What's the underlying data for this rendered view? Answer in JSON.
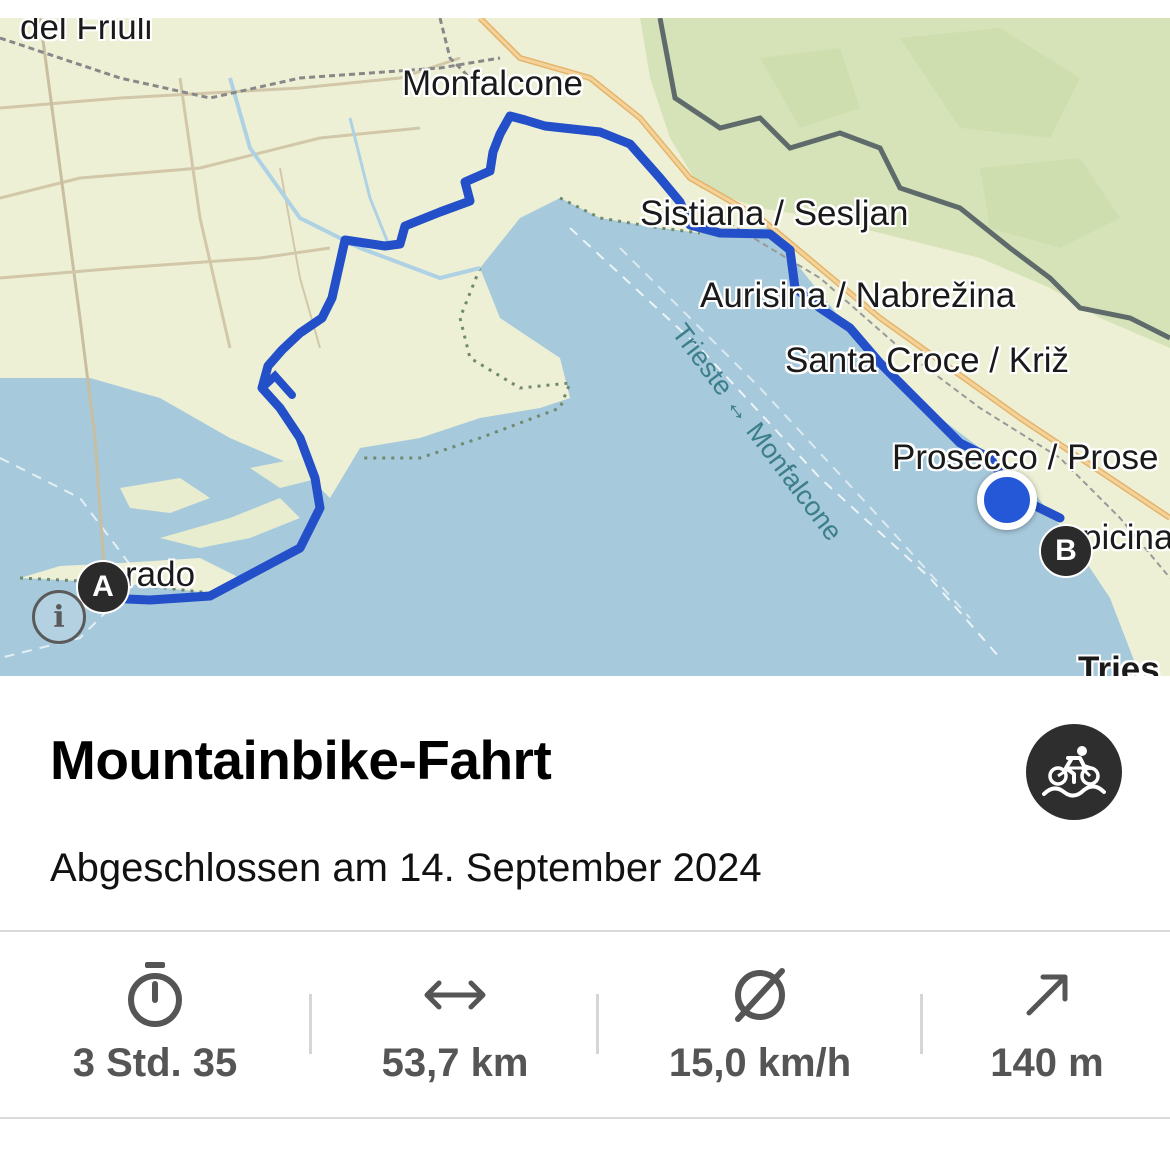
{
  "map": {
    "places": {
      "monfalcone": "Monfalcone",
      "sistiana": "Sistiana / Sesljan",
      "aurisina": "Aurisina / Nabrežina",
      "santa_croce": "Santa Croce / Križ",
      "prosecco": "Prosecco / Prose",
      "opicina": "picina",
      "grado": "rado",
      "friuli": "del Friuli",
      "trieste": "Tries"
    },
    "ferry_line": "Trieste ↔ Monfalcone",
    "start_marker": "A",
    "end_marker": "B",
    "info_icon": "i",
    "colors": {
      "route": "#2350c8",
      "sea": "#a6c9dc",
      "land": "#eef0d6",
      "hills": "#d4e2b8",
      "border": "#5f6b6b"
    }
  },
  "activity": {
    "title": "Mountainbike-Fahrt",
    "icon": "mountain-bike-icon",
    "completed": "Abgeschlossen am 14. September 2024"
  },
  "stats": [
    {
      "icon": "stopwatch-icon",
      "value": "3 Std. 35"
    },
    {
      "icon": "distance-arrows-icon",
      "value": "53,7 km"
    },
    {
      "icon": "average-speed-icon",
      "value": "15,0 km/h"
    },
    {
      "icon": "elevation-gain-icon",
      "value": "140 m"
    }
  ]
}
